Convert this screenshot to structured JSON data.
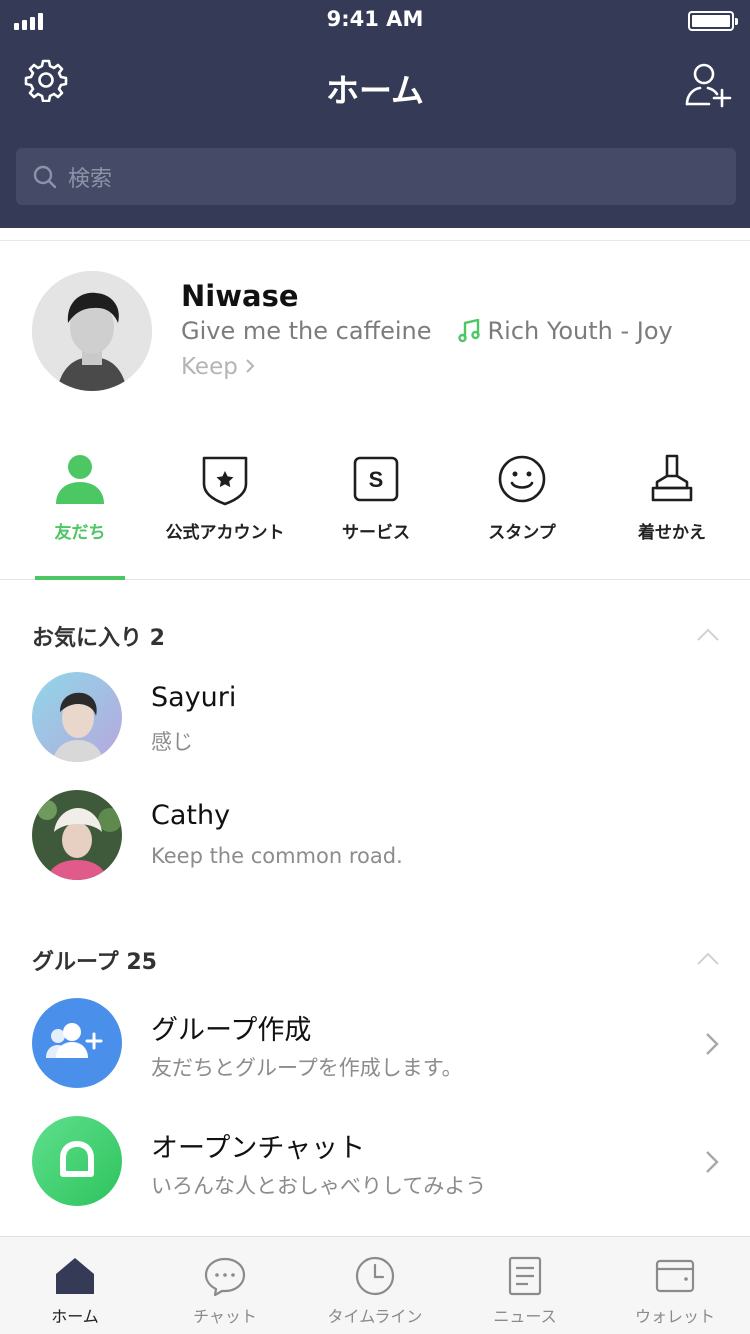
{
  "status_bar": {
    "time": "9:41 AM"
  },
  "header": {
    "title": "ホーム",
    "settings_icon": "gear-icon",
    "add_friend_icon": "add-user-icon"
  },
  "search": {
    "placeholder": "検索"
  },
  "profile": {
    "name": "Niwase",
    "status_message": "Give me the caffeine",
    "music": "Rich Youth - Joy",
    "keep_label": "Keep"
  },
  "categories": [
    {
      "label": "友だち",
      "icon": "person-icon",
      "active": true
    },
    {
      "label": "公式アカウント",
      "icon": "shield-star-icon",
      "active": false
    },
    {
      "label": "サービス",
      "icon": "service-s-icon",
      "active": false
    },
    {
      "label": "スタンプ",
      "icon": "smiley-icon",
      "active": false
    },
    {
      "label": "着せかえ",
      "icon": "brush-icon",
      "active": false
    }
  ],
  "favorites": {
    "title": "お気に入り 2",
    "items": [
      {
        "name": "Sayuri",
        "status": "感じ"
      },
      {
        "name": "Cathy",
        "status": "Keep the common road."
      }
    ]
  },
  "groups": {
    "title": "グループ 25",
    "items": [
      {
        "name": "グループ作成",
        "status": "友だちとグループを作成します。",
        "icon": "add-group-icon",
        "color": "#4a90ea"
      },
      {
        "name": "オープンチャット",
        "status": "いろんな人とおしゃべりしてみよう",
        "icon": "open-chat-icon",
        "color": "#3fcf71"
      }
    ]
  },
  "tabbar": [
    {
      "label": "ホーム",
      "icon": "home-icon",
      "active": true
    },
    {
      "label": "チャット",
      "icon": "chat-icon",
      "active": false
    },
    {
      "label": "タイムライン",
      "icon": "clock-icon",
      "active": false
    },
    {
      "label": "ニュース",
      "icon": "news-icon",
      "active": false
    },
    {
      "label": "ウォレット",
      "icon": "wallet-icon",
      "active": false
    }
  ],
  "colors": {
    "header_bg": "#353b56",
    "accent_green": "#4cc764",
    "search_bg": "#454b66"
  }
}
